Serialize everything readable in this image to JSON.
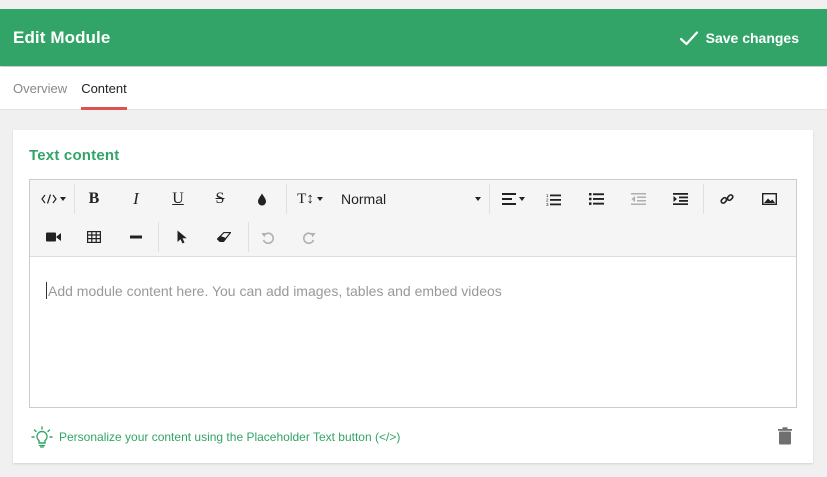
{
  "header": {
    "title": "Edit Module",
    "save_label": "Save changes",
    "accent": "#33a467"
  },
  "tabs": [
    {
      "label": "Overview",
      "active": false
    },
    {
      "label": "Content",
      "active": true
    }
  ],
  "card": {
    "title": "Text content",
    "toolbar": {
      "style_value": "Normal",
      "buttons": [
        "code-view-icon",
        "bold-icon",
        "italic-icon",
        "underline-icon",
        "strikethrough-icon",
        "color-drop-icon",
        "font-size-icon",
        "align-icon",
        "ordered-list-icon",
        "unordered-list-icon",
        "outdent-icon",
        "indent-icon",
        "link-icon",
        "image-icon",
        "video-icon",
        "table-icon",
        "horizontal-rule-icon",
        "pointer-icon",
        "eraser-icon",
        "undo-icon",
        "redo-icon"
      ],
      "bold_glyph": "B",
      "italic_glyph": "I",
      "underline_glyph": "U",
      "strike_glyph": "S",
      "fontsize_glyph": "T↕"
    },
    "placeholder": "Add module content here. You can add images, tables and embed videos",
    "tip": "Personalize your content using the Placeholder Text button (</>)"
  }
}
